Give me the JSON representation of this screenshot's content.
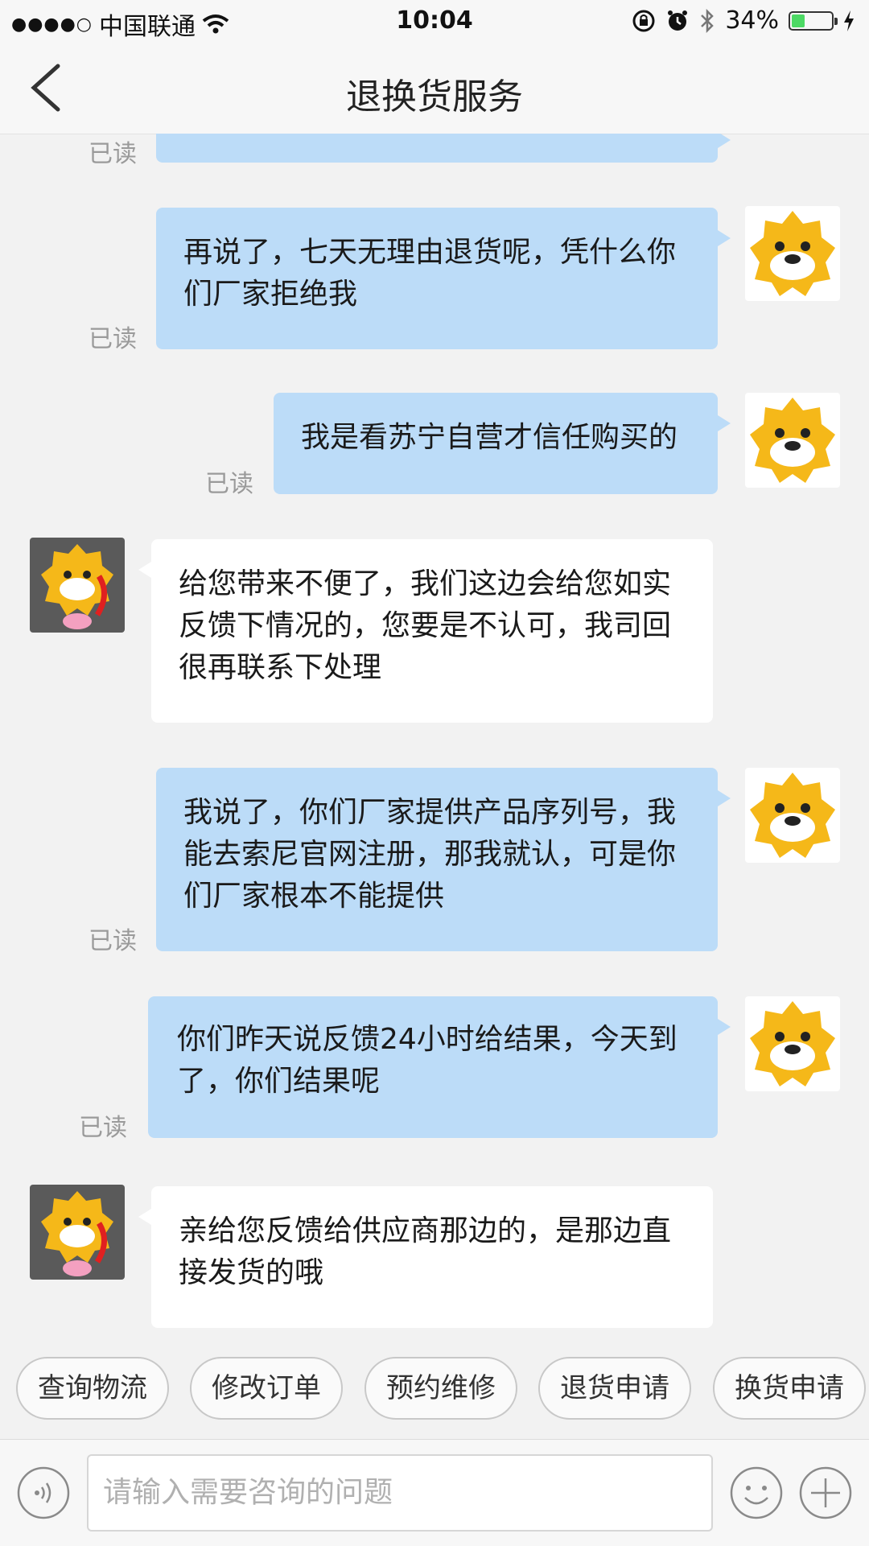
{
  "status_bar": {
    "carrier": "中国联通",
    "time": "10:04",
    "battery_percent": "34%",
    "battery_level": 0.34
  },
  "nav": {
    "title": "退换货服务",
    "back_icon": "chevron-left-icon"
  },
  "messages": [
    {
      "from": "user",
      "text": "",
      "read": "已读"
    },
    {
      "from": "user",
      "text": "再说了，七天无理由退货呢，凭什么你们厂家拒绝我",
      "read": "已读"
    },
    {
      "from": "user",
      "text": "我是看苏宁自营才信任购买的",
      "read": "已读"
    },
    {
      "from": "agent",
      "text": "给您带来不便了，我们这边会给您如实反馈下情况的，您要是不认可，我司回很再联系下处理"
    },
    {
      "from": "user",
      "text": "我说了，你们厂家提供产品序列号，我能去索尼官网注册，那我就认，可是你们厂家根本不能提供",
      "read": "已读"
    },
    {
      "from": "user",
      "text": "你们昨天说反馈24小时给结果，今天到了，你们结果呢",
      "read": "已读"
    },
    {
      "from": "agent",
      "text": "亲给您反馈给供应商那边的，是那边直接发货的哦"
    }
  ],
  "quick_replies": [
    "查询物流",
    "修改订单",
    "预约维修",
    "退货申请",
    "换货申请"
  ],
  "input": {
    "placeholder": "请输入需要咨询的问题",
    "voice_icon": "voice-icon",
    "emoji_icon": "emoji-icon",
    "plus_icon": "plus-icon"
  },
  "colors": {
    "outgoing_bubble": "#bcdcf8",
    "incoming_bubble": "#ffffff",
    "background": "#f2f2f2",
    "mascot_yellow": "#f5b819"
  }
}
